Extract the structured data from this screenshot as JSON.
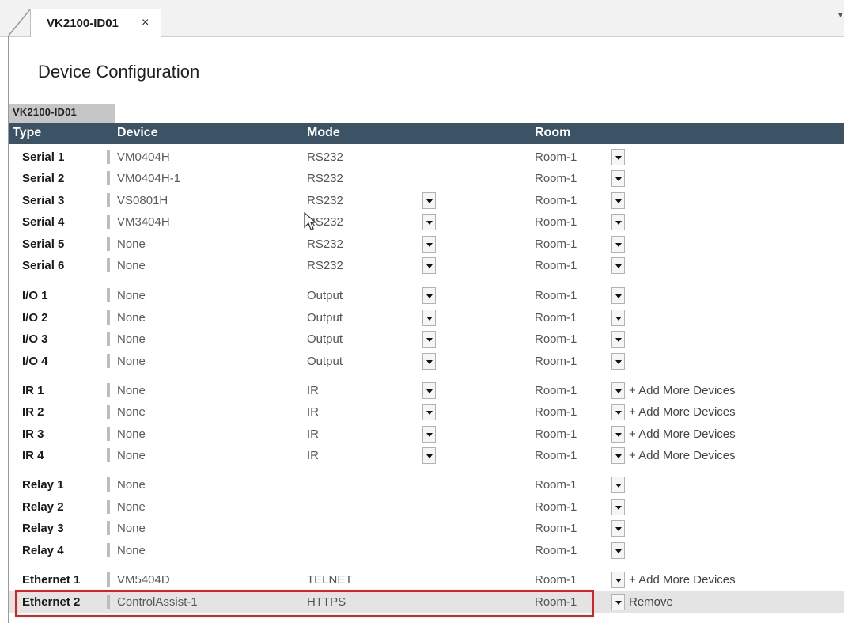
{
  "tab": {
    "title": "VK2100-ID01",
    "close": "×"
  },
  "page_title": "Device Configuration",
  "subtab": "VK2100-ID01",
  "columns": {
    "type": "Type",
    "device": "Device",
    "mode": "Mode",
    "room": "Room"
  },
  "rows": [
    {
      "type": "Serial 1",
      "device": "VM0404H",
      "mode": "RS232",
      "room": "Room-1",
      "action": ""
    },
    {
      "type": "Serial 2",
      "device": "VM0404H-1",
      "mode": "RS232",
      "room": "Room-1",
      "action": ""
    },
    {
      "type": "Serial 3",
      "device": "VS0801H",
      "mode": "RS232",
      "room": "Room-1",
      "action": ""
    },
    {
      "type": "Serial 4",
      "device": "VM3404H",
      "mode": "RS232",
      "room": "Room-1",
      "action": ""
    },
    {
      "type": "Serial 5",
      "device": "None",
      "mode": "RS232",
      "room": "Room-1",
      "action": ""
    },
    {
      "type": "Serial 6",
      "device": "None",
      "mode": "RS232",
      "room": "Room-1",
      "action": ""
    },
    {
      "type": "I/O 1",
      "device": "None",
      "mode": "Output",
      "room": "Room-1",
      "action": ""
    },
    {
      "type": "I/O 2",
      "device": "None",
      "mode": "Output",
      "room": "Room-1",
      "action": ""
    },
    {
      "type": "I/O 3",
      "device": "None",
      "mode": "Output",
      "room": "Room-1",
      "action": ""
    },
    {
      "type": "I/O 4",
      "device": "None",
      "mode": "Output",
      "room": "Room-1",
      "action": ""
    },
    {
      "type": "IR 1",
      "device": "None",
      "mode": "IR",
      "room": "Room-1",
      "action": "+ Add More Devices"
    },
    {
      "type": "IR 2",
      "device": "None",
      "mode": "IR",
      "room": "Room-1",
      "action": "+ Add More Devices"
    },
    {
      "type": "IR 3",
      "device": "None",
      "mode": "IR",
      "room": "Room-1",
      "action": "+ Add More Devices"
    },
    {
      "type": "IR 4",
      "device": "None",
      "mode": "IR",
      "room": "Room-1",
      "action": "+ Add More Devices"
    },
    {
      "type": "Relay 1",
      "device": "None",
      "mode": "",
      "room": "Room-1",
      "action": ""
    },
    {
      "type": "Relay 2",
      "device": "None",
      "mode": "",
      "room": "Room-1",
      "action": ""
    },
    {
      "type": "Relay 3",
      "device": "None",
      "mode": "",
      "room": "Room-1",
      "action": ""
    },
    {
      "type": "Relay 4",
      "device": "None",
      "mode": "",
      "room": "Room-1",
      "action": ""
    },
    {
      "type": "Ethernet 1",
      "device": "VM5404D",
      "mode": "TELNET",
      "room": "Room-1",
      "action": "+ Add More Devices"
    },
    {
      "type": "Ethernet 2",
      "device": "ControlAssist-1",
      "mode": "HTTPS",
      "room": "Room-1",
      "action": "Remove"
    }
  ],
  "colors": {
    "header_bg": "#3c5365",
    "highlight": "#e01f1f",
    "selected_row": "#e4e4e4"
  },
  "icons": {
    "dropdown": "chevron-down-icon",
    "close": "close-icon",
    "cursor": "mouse-cursor-icon"
  }
}
